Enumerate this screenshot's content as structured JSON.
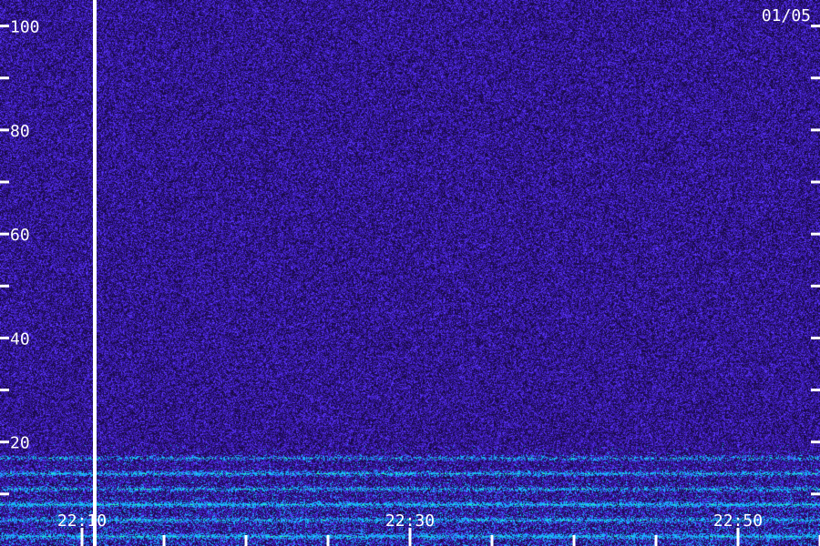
{
  "chart_data": {
    "type": "heatmap",
    "date_label": "01/05",
    "y_axis": {
      "range": [
        0,
        105
      ],
      "major_ticks": [
        20,
        40,
        60,
        80,
        100
      ],
      "major_tick_labels": [
        "20",
        "40",
        "60",
        "80",
        "100"
      ],
      "minor_ticks": [
        10,
        30,
        50,
        70,
        90
      ]
    },
    "x_axis": {
      "range": [
        "22:05",
        "22:55"
      ],
      "tick_labels": [
        "22:10",
        "22:30",
        "22:50"
      ],
      "labeled_ticks": [
        "22:10",
        "22:30",
        "22:50"
      ],
      "minor_ticks": [
        "22:15",
        "22:20",
        "22:25",
        "22:35",
        "22:40",
        "22:45",
        "22:55"
      ]
    },
    "vertical_marker": "22:10",
    "colors": {
      "background": "#1a0a4a",
      "noise_low": "#1a0a4a",
      "noise_mid": "#3a1ab0",
      "noise_high": "#5a36ff",
      "band_cyan": "#18b0ff",
      "band_green": "#30ffa0",
      "marker": "#ffffff",
      "text": "#ffffff"
    },
    "bands": [
      {
        "y": 17,
        "intensity": 0.55
      },
      {
        "y": 14,
        "intensity": 0.8
      },
      {
        "y": 11,
        "intensity": 0.65
      },
      {
        "y": 8,
        "intensity": 1.0
      },
      {
        "y": 5,
        "intensity": 0.75
      },
      {
        "y": 2,
        "intensity": 0.9
      }
    ]
  }
}
